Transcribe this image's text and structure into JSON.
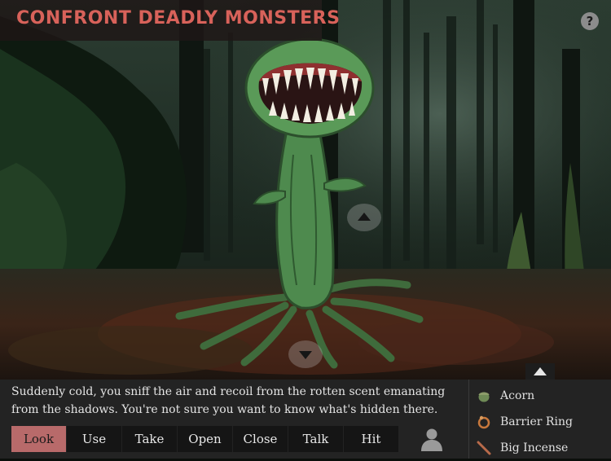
{
  "header": {
    "title": "CONFRONT DEADLY MONSTERS",
    "help_label": "?"
  },
  "narration": "Suddenly cold, you sniff the air and recoil from the rotten scent emanating from the shadows. You're not sure you want to know what's hidden there.",
  "verbs": [
    {
      "label": "Look",
      "active": true
    },
    {
      "label": "Use"
    },
    {
      "label": "Take"
    },
    {
      "label": "Open"
    },
    {
      "label": "Close"
    },
    {
      "label": "Talk"
    },
    {
      "label": "Hit"
    }
  ],
  "inventory": [
    {
      "label": "Acorn",
      "icon": "acorn-icon",
      "color": "#6f8a56"
    },
    {
      "label": "Barrier Ring",
      "icon": "ring-icon",
      "color": "#c8783c"
    },
    {
      "label": "Big Incense",
      "icon": "incense-icon",
      "color": "#b86a4a"
    }
  ],
  "colors": {
    "title": "#d8625a",
    "active_verb": "#b86a6a",
    "monster": "#4e8a4e"
  }
}
